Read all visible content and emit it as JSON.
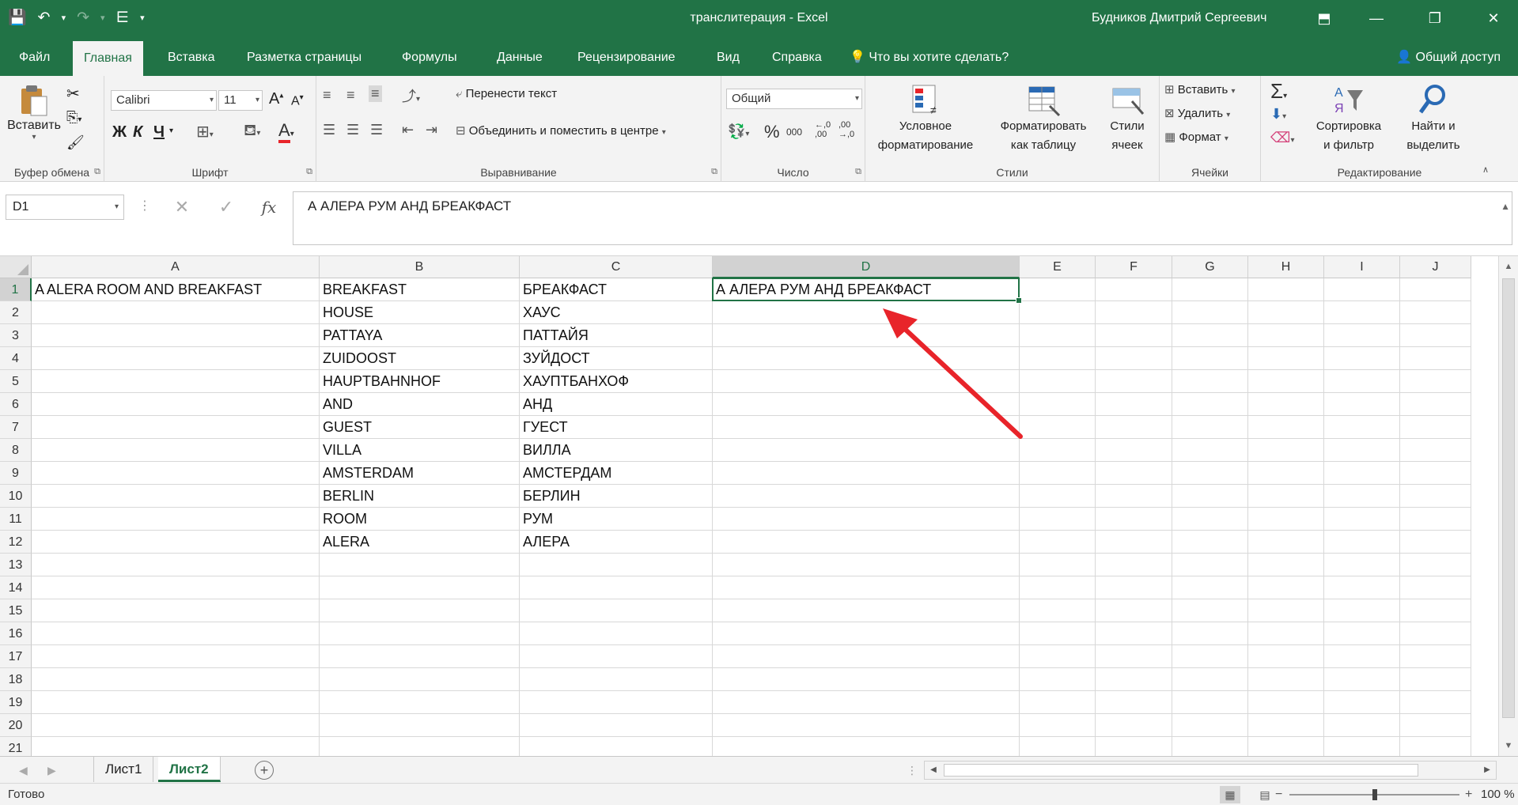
{
  "title_bar": {
    "document_title": "транслитерация  -  Excel",
    "user_name": "Будников Дмитрий Сергеевич",
    "colors": {
      "accent": "#217346"
    }
  },
  "quick_access": {
    "save_icon": "💾",
    "undo_icon": "↶",
    "redo_icon": "↷",
    "custom_icon": "⋿",
    "more_icon": "▾"
  },
  "window_buttons": {
    "ribbon_display_icon": "⬒",
    "minimize_icon": "—",
    "restore_icon": "❐",
    "close_icon": "✕"
  },
  "tabs": [
    {
      "label": "Файл"
    },
    {
      "label": "Главная",
      "active": true
    },
    {
      "label": "Вставка"
    },
    {
      "label": "Разметка страницы"
    },
    {
      "label": "Формулы"
    },
    {
      "label": "Данные"
    },
    {
      "label": "Рецензирование"
    },
    {
      "label": "Вид"
    },
    {
      "label": "Справка"
    },
    {
      "label": "Что вы хотите сделать?"
    }
  ],
  "share_label": "Общий доступ",
  "ribbon": {
    "clipboard": {
      "label": "Буфер обмена",
      "paste_label": "Вставить"
    },
    "font": {
      "label": "Шрифт",
      "font_name": "Calibri",
      "font_size": "11",
      "bold": "Ж",
      "italic": "К",
      "underline": "Ч",
      "grow": "A",
      "shrink": "A"
    },
    "alignment": {
      "label": "Выравнивание",
      "wrap_text": "Перенести текст",
      "merge_center": "Объединить и поместить в центре"
    },
    "number": {
      "label": "Число",
      "format": "Общий",
      "percent": "%",
      "thousands": "000",
      "inc_decimal": "←,0\n,00",
      "dec_decimal": ",00\n→,0"
    },
    "styles": {
      "label": "Стили",
      "conditional": "Условное\nформатирование",
      "format_table": "Форматировать\nкак таблицу",
      "cell_styles": "Стили\nячеек"
    },
    "cells": {
      "label": "Ячейки",
      "insert": "Вставить",
      "delete": "Удалить",
      "format": "Формат"
    },
    "editing": {
      "label": "Редактирование",
      "sort_filter": "Сортировка\nи фильтр",
      "find_select": "Найти и\nвыделить"
    }
  },
  "formula_bar": {
    "name_box": "D1",
    "formula": "А АЛЕРА РУМ АНД БРЕАКФАСТ",
    "cancel_icon": "✕",
    "enter_icon": "✓",
    "fx_label": "fx"
  },
  "grid": {
    "columns": [
      "A",
      "B",
      "C",
      "D",
      "E",
      "F",
      "G",
      "H",
      "I",
      "J"
    ],
    "selected_column": "D",
    "rows": [
      "1",
      "2",
      "3",
      "4",
      "5",
      "6",
      "7",
      "8",
      "9",
      "10",
      "11",
      "12",
      "13",
      "14",
      "15",
      "16",
      "17",
      "18",
      "19",
      "20",
      "21"
    ],
    "selected_row": "1",
    "cells": {
      "A1": "A ALERA ROOM AND BREAKFAST",
      "B1": "BREAKFAST",
      "C1": "БРЕАКФАСТ",
      "D1": "А АЛЕРА РУМ АНД БРЕАКФАСТ",
      "B2": "HOUSE",
      "C2": "ХАУС",
      "B3": "PATTAYA",
      "C3": "ПАТТАЙЯ",
      "B4": "ZUIDOOST",
      "C4": "ЗУЙДОСТ",
      "B5": "HAUPTBAHNHOF",
      "C5": "ХАУПТБАНХОФ",
      "B6": "AND",
      "C6": "АНД",
      "B7": "GUEST",
      "C7": "ГУЕСТ",
      "B8": "VILLA",
      "C8": "ВИЛЛА",
      "B9": "AMSTERDAM",
      "C9": "АМСТЕРДАМ",
      "B10": "BERLIN",
      "C10": "БЕРЛИН",
      "B11": "ROOM",
      "C11": "РУМ",
      "B12": "ALERA",
      "C12": "АЛЕРА"
    },
    "annotation_color": "#e8242a"
  },
  "sheets": [
    {
      "label": "Лист1"
    },
    {
      "label": "Лист2",
      "active": true
    }
  ],
  "status": {
    "ready": "Готово",
    "zoom": "100 %",
    "zoom_fraction": 0.5
  }
}
